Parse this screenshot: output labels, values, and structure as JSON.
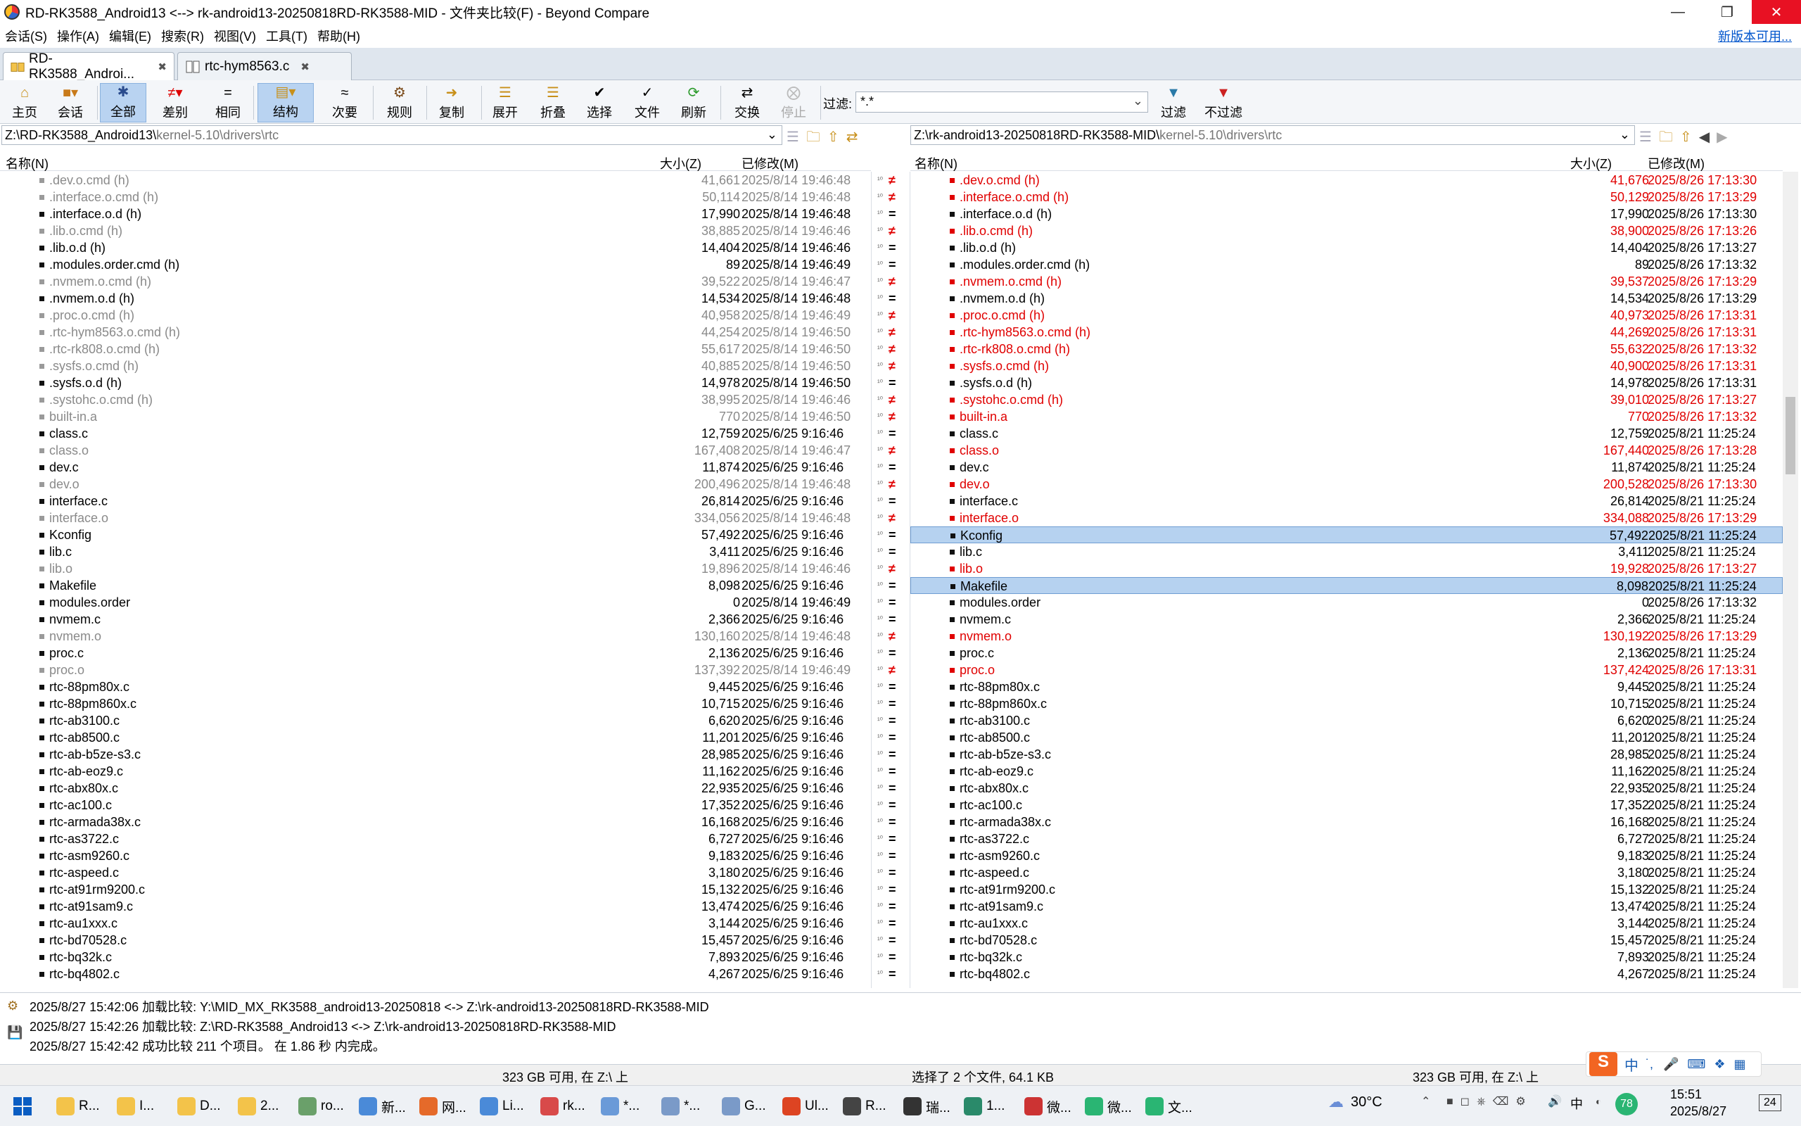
{
  "window": {
    "title": "RD-RK3588_Android13 <--> rk-android13-20250818RD-RK3588-MID - 文件夹比较(F) - Beyond Compare"
  },
  "menu": {
    "items": [
      "会话(S)",
      "操作(A)",
      "编辑(E)",
      "搜索(R)",
      "视图(V)",
      "工具(T)",
      "帮助(H)"
    ],
    "new_version": "新版本可用..."
  },
  "tabs": [
    {
      "label": "RD-RK3588_Androi..."
    },
    {
      "label": "rtc-hym8563.c"
    }
  ],
  "toolbar": {
    "buttons": [
      "主页",
      "会话",
      "全部",
      "差别",
      "相同",
      "结构",
      "次要",
      "规则",
      "复制",
      "展开",
      "折叠",
      "选择",
      "文件",
      "刷新",
      "交换",
      "停止"
    ],
    "filter_label": "过滤:",
    "filter_value": "*.*",
    "filter_btn": "过滤",
    "nofilter_btn": "不过滤"
  },
  "left": {
    "path_prefix": "Z:\\RD-RK3588_Android13\\",
    "path_suffix": "kernel-5.10\\drivers\\rtc",
    "col_name": "名称(N)",
    "col_size": "大小(Z)",
    "col_mod": "已修改(M)",
    "rows": [
      {
        "name": ".dev.o.cmd (h)",
        "size": "41,661",
        "date": "2025/8/14 19:46:48",
        "s": "gray"
      },
      {
        "name": ".interface.o.cmd (h)",
        "size": "50,114",
        "date": "2025/8/14 19:46:48",
        "s": "gray"
      },
      {
        "name": ".interface.o.d (h)",
        "size": "17,990",
        "date": "2025/8/14 19:46:48",
        "s": ""
      },
      {
        "name": ".lib.o.cmd (h)",
        "size": "38,885",
        "date": "2025/8/14 19:46:46",
        "s": "gray"
      },
      {
        "name": ".lib.o.d (h)",
        "size": "14,404",
        "date": "2025/8/14 19:46:46",
        "s": ""
      },
      {
        "name": ".modules.order.cmd (h)",
        "size": "89",
        "date": "2025/8/14 19:46:49",
        "s": ""
      },
      {
        "name": ".nvmem.o.cmd (h)",
        "size": "39,522",
        "date": "2025/8/14 19:46:47",
        "s": "gray"
      },
      {
        "name": ".nvmem.o.d (h)",
        "size": "14,534",
        "date": "2025/8/14 19:46:48",
        "s": ""
      },
      {
        "name": ".proc.o.cmd (h)",
        "size": "40,958",
        "date": "2025/8/14 19:46:49",
        "s": "gray"
      },
      {
        "name": ".rtc-hym8563.o.cmd (h)",
        "size": "44,254",
        "date": "2025/8/14 19:46:50",
        "s": "gray"
      },
      {
        "name": ".rtc-rk808.o.cmd (h)",
        "size": "55,617",
        "date": "2025/8/14 19:46:50",
        "s": "gray"
      },
      {
        "name": ".sysfs.o.cmd (h)",
        "size": "40,885",
        "date": "2025/8/14 19:46:50",
        "s": "gray"
      },
      {
        "name": ".sysfs.o.d (h)",
        "size": "14,978",
        "date": "2025/8/14 19:46:50",
        "s": ""
      },
      {
        "name": ".systohc.o.cmd (h)",
        "size": "38,995",
        "date": "2025/8/14 19:46:46",
        "s": "gray"
      },
      {
        "name": "built-in.a",
        "size": "770",
        "date": "2025/8/14 19:46:50",
        "s": "gray"
      },
      {
        "name": "class.c",
        "size": "12,759",
        "date": "2025/6/25 9:16:46",
        "s": ""
      },
      {
        "name": "class.o",
        "size": "167,408",
        "date": "2025/8/14 19:46:47",
        "s": "gray"
      },
      {
        "name": "dev.c",
        "size": "11,874",
        "date": "2025/6/25 9:16:46",
        "s": ""
      },
      {
        "name": "dev.o",
        "size": "200,496",
        "date": "2025/8/14 19:46:48",
        "s": "gray"
      },
      {
        "name": "interface.c",
        "size": "26,814",
        "date": "2025/6/25 9:16:46",
        "s": ""
      },
      {
        "name": "interface.o",
        "size": "334,056",
        "date": "2025/8/14 19:46:48",
        "s": "gray"
      },
      {
        "name": "Kconfig",
        "size": "57,492",
        "date": "2025/6/25 9:16:46",
        "s": ""
      },
      {
        "name": "lib.c",
        "size": "3,411",
        "date": "2025/6/25 9:16:46",
        "s": ""
      },
      {
        "name": "lib.o",
        "size": "19,896",
        "date": "2025/8/14 19:46:46",
        "s": "gray"
      },
      {
        "name": "Makefile",
        "size": "8,098",
        "date": "2025/6/25 9:16:46",
        "s": ""
      },
      {
        "name": "modules.order",
        "size": "0",
        "date": "2025/8/14 19:46:49",
        "s": ""
      },
      {
        "name": "nvmem.c",
        "size": "2,366",
        "date": "2025/6/25 9:16:46",
        "s": ""
      },
      {
        "name": "nvmem.o",
        "size": "130,160",
        "date": "2025/8/14 19:46:48",
        "s": "gray"
      },
      {
        "name": "proc.c",
        "size": "2,136",
        "date": "2025/6/25 9:16:46",
        "s": ""
      },
      {
        "name": "proc.o",
        "size": "137,392",
        "date": "2025/8/14 19:46:49",
        "s": "gray"
      },
      {
        "name": "rtc-88pm80x.c",
        "size": "9,445",
        "date": "2025/6/25 9:16:46",
        "s": ""
      },
      {
        "name": "rtc-88pm860x.c",
        "size": "10,715",
        "date": "2025/6/25 9:16:46",
        "s": ""
      },
      {
        "name": "rtc-ab3100.c",
        "size": "6,620",
        "date": "2025/6/25 9:16:46",
        "s": ""
      },
      {
        "name": "rtc-ab8500.c",
        "size": "11,201",
        "date": "2025/6/25 9:16:46",
        "s": ""
      },
      {
        "name": "rtc-ab-b5ze-s3.c",
        "size": "28,985",
        "date": "2025/6/25 9:16:46",
        "s": ""
      },
      {
        "name": "rtc-ab-eoz9.c",
        "size": "11,162",
        "date": "2025/6/25 9:16:46",
        "s": ""
      },
      {
        "name": "rtc-abx80x.c",
        "size": "22,935",
        "date": "2025/6/25 9:16:46",
        "s": ""
      },
      {
        "name": "rtc-ac100.c",
        "size": "17,352",
        "date": "2025/6/25 9:16:46",
        "s": ""
      },
      {
        "name": "rtc-armada38x.c",
        "size": "16,168",
        "date": "2025/6/25 9:16:46",
        "s": ""
      },
      {
        "name": "rtc-as3722.c",
        "size": "6,727",
        "date": "2025/6/25 9:16:46",
        "s": ""
      },
      {
        "name": "rtc-asm9260.c",
        "size": "9,183",
        "date": "2025/6/25 9:16:46",
        "s": ""
      },
      {
        "name": "rtc-aspeed.c",
        "size": "3,180",
        "date": "2025/6/25 9:16:46",
        "s": ""
      },
      {
        "name": "rtc-at91rm9200.c",
        "size": "15,132",
        "date": "2025/6/25 9:16:46",
        "s": ""
      },
      {
        "name": "rtc-at91sam9.c",
        "size": "13,474",
        "date": "2025/6/25 9:16:46",
        "s": ""
      },
      {
        "name": "rtc-au1xxx.c",
        "size": "3,144",
        "date": "2025/6/25 9:16:46",
        "s": ""
      },
      {
        "name": "rtc-bd70528.c",
        "size": "15,457",
        "date": "2025/6/25 9:16:46",
        "s": ""
      },
      {
        "name": "rtc-bq32k.c",
        "size": "7,893",
        "date": "2025/6/25 9:16:46",
        "s": ""
      },
      {
        "name": "rtc-bq4802.c",
        "size": "4,267",
        "date": "2025/6/25 9:16:46",
        "s": ""
      }
    ]
  },
  "right": {
    "path_prefix": "Z:\\rk-android13-20250818RD-RK3588-MID\\",
    "path_suffix": "kernel-5.10\\drivers\\rtc",
    "col_name": "名称(N)",
    "col_size": "大小(Z)",
    "col_mod": "已修改(M)",
    "rows": [
      {
        "name": ".dev.o.cmd (h)",
        "size": "41,676",
        "date": "2025/8/26 17:13:30",
        "s": "red"
      },
      {
        "name": ".interface.o.cmd (h)",
        "size": "50,129",
        "date": "2025/8/26 17:13:29",
        "s": "red"
      },
      {
        "name": ".interface.o.d (h)",
        "size": "17,990",
        "date": "2025/8/26 17:13:30",
        "s": ""
      },
      {
        "name": ".lib.o.cmd (h)",
        "size": "38,900",
        "date": "2025/8/26 17:13:26",
        "s": "red"
      },
      {
        "name": ".lib.o.d (h)",
        "size": "14,404",
        "date": "2025/8/26 17:13:27",
        "s": ""
      },
      {
        "name": ".modules.order.cmd (h)",
        "size": "89",
        "date": "2025/8/26 17:13:32",
        "s": ""
      },
      {
        "name": ".nvmem.o.cmd (h)",
        "size": "39,537",
        "date": "2025/8/26 17:13:29",
        "s": "red"
      },
      {
        "name": ".nvmem.o.d (h)",
        "size": "14,534",
        "date": "2025/8/26 17:13:29",
        "s": ""
      },
      {
        "name": ".proc.o.cmd (h)",
        "size": "40,973",
        "date": "2025/8/26 17:13:31",
        "s": "red"
      },
      {
        "name": ".rtc-hym8563.o.cmd (h)",
        "size": "44,269",
        "date": "2025/8/26 17:13:31",
        "s": "red"
      },
      {
        "name": ".rtc-rk808.o.cmd (h)",
        "size": "55,632",
        "date": "2025/8/26 17:13:32",
        "s": "red"
      },
      {
        "name": ".sysfs.o.cmd (h)",
        "size": "40,900",
        "date": "2025/8/26 17:13:31",
        "s": "red"
      },
      {
        "name": ".sysfs.o.d (h)",
        "size": "14,978",
        "date": "2025/8/26 17:13:31",
        "s": ""
      },
      {
        "name": ".systohc.o.cmd (h)",
        "size": "39,010",
        "date": "2025/8/26 17:13:27",
        "s": "red"
      },
      {
        "name": "built-in.a",
        "size": "770",
        "date": "2025/8/26 17:13:32",
        "s": "red"
      },
      {
        "name": "class.c",
        "size": "12,759",
        "date": "2025/8/21 11:25:24",
        "s": ""
      },
      {
        "name": "class.o",
        "size": "167,440",
        "date": "2025/8/26 17:13:28",
        "s": "red"
      },
      {
        "name": "dev.c",
        "size": "11,874",
        "date": "2025/8/21 11:25:24",
        "s": ""
      },
      {
        "name": "dev.o",
        "size": "200,528",
        "date": "2025/8/26 17:13:30",
        "s": "red"
      },
      {
        "name": "interface.c",
        "size": "26,814",
        "date": "2025/8/21 11:25:24",
        "s": ""
      },
      {
        "name": "interface.o",
        "size": "334,088",
        "date": "2025/8/26 17:13:29",
        "s": "red"
      },
      {
        "name": "Kconfig",
        "size": "57,492",
        "date": "2025/8/21 11:25:24",
        "s": "sel"
      },
      {
        "name": "lib.c",
        "size": "3,411",
        "date": "2025/8/21 11:25:24",
        "s": ""
      },
      {
        "name": "lib.o",
        "size": "19,928",
        "date": "2025/8/26 17:13:27",
        "s": "red"
      },
      {
        "name": "Makefile",
        "size": "8,098",
        "date": "2025/8/21 11:25:24",
        "s": "sel"
      },
      {
        "name": "modules.order",
        "size": "0",
        "date": "2025/8/26 17:13:32",
        "s": ""
      },
      {
        "name": "nvmem.c",
        "size": "2,366",
        "date": "2025/8/21 11:25:24",
        "s": ""
      },
      {
        "name": "nvmem.o",
        "size": "130,192",
        "date": "2025/8/26 17:13:29",
        "s": "red"
      },
      {
        "name": "proc.c",
        "size": "2,136",
        "date": "2025/8/21 11:25:24",
        "s": ""
      },
      {
        "name": "proc.o",
        "size": "137,424",
        "date": "2025/8/26 17:13:31",
        "s": "red"
      },
      {
        "name": "rtc-88pm80x.c",
        "size": "9,445",
        "date": "2025/8/21 11:25:24",
        "s": ""
      },
      {
        "name": "rtc-88pm860x.c",
        "size": "10,715",
        "date": "2025/8/21 11:25:24",
        "s": ""
      },
      {
        "name": "rtc-ab3100.c",
        "size": "6,620",
        "date": "2025/8/21 11:25:24",
        "s": ""
      },
      {
        "name": "rtc-ab8500.c",
        "size": "11,201",
        "date": "2025/8/21 11:25:24",
        "s": ""
      },
      {
        "name": "rtc-ab-b5ze-s3.c",
        "size": "28,985",
        "date": "2025/8/21 11:25:24",
        "s": ""
      },
      {
        "name": "rtc-ab-eoz9.c",
        "size": "11,162",
        "date": "2025/8/21 11:25:24",
        "s": ""
      },
      {
        "name": "rtc-abx80x.c",
        "size": "22,935",
        "date": "2025/8/21 11:25:24",
        "s": ""
      },
      {
        "name": "rtc-ac100.c",
        "size": "17,352",
        "date": "2025/8/21 11:25:24",
        "s": ""
      },
      {
        "name": "rtc-armada38x.c",
        "size": "16,168",
        "date": "2025/8/21 11:25:24",
        "s": ""
      },
      {
        "name": "rtc-as3722.c",
        "size": "6,727",
        "date": "2025/8/21 11:25:24",
        "s": ""
      },
      {
        "name": "rtc-asm9260.c",
        "size": "9,183",
        "date": "2025/8/21 11:25:24",
        "s": ""
      },
      {
        "name": "rtc-aspeed.c",
        "size": "3,180",
        "date": "2025/8/21 11:25:24",
        "s": ""
      },
      {
        "name": "rtc-at91rm9200.c",
        "size": "15,132",
        "date": "2025/8/21 11:25:24",
        "s": ""
      },
      {
        "name": "rtc-at91sam9.c",
        "size": "13,474",
        "date": "2025/8/21 11:25:24",
        "s": ""
      },
      {
        "name": "rtc-au1xxx.c",
        "size": "3,144",
        "date": "2025/8/21 11:25:24",
        "s": ""
      },
      {
        "name": "rtc-bd70528.c",
        "size": "15,457",
        "date": "2025/8/21 11:25:24",
        "s": ""
      },
      {
        "name": "rtc-bq32k.c",
        "size": "7,893",
        "date": "2025/8/21 11:25:24",
        "s": ""
      },
      {
        "name": "rtc-bq4802.c",
        "size": "4,267",
        "date": "2025/8/21 11:25:24",
        "s": ""
      }
    ]
  },
  "markers": [
    "ne",
    "ne",
    "eq",
    "ne",
    "eq",
    "eq",
    "ne",
    "eq",
    "ne",
    "ne",
    "ne",
    "ne",
    "eq",
    "ne",
    "ne",
    "eq",
    "ne",
    "eq",
    "ne",
    "eq",
    "ne",
    "eq",
    "eq",
    "ne",
    "eq",
    "eq",
    "eq",
    "ne",
    "eq",
    "ne",
    "eq",
    "eq",
    "eq",
    "eq",
    "eq",
    "eq",
    "eq",
    "eq",
    "eq",
    "eq",
    "eq",
    "eq",
    "eq",
    "eq",
    "eq",
    "eq",
    "eq",
    "eq"
  ],
  "log": [
    "2025/8/27 15:42:06  加载比较: Y:\\MID_MX_RK3588_android13-20250818 <-> Z:\\rk-android13-20250818RD-RK3588-MID",
    "2025/8/27 15:42:26  加载比较: Z:\\RD-RK3588_Android13 <-> Z:\\rk-android13-20250818RD-RK3588-MID",
    "2025/8/27 15:42:42  成功比较 211 个项目。 在 1.86 秒 内完成。"
  ],
  "status": {
    "left_free": "323 GB 可用, 在 Z:\\ 上",
    "selection": "选择了 2 个文件, 64.1 KB",
    "right_free": "323 GB 可用, 在 Z:\\ 上"
  },
  "taskbar": {
    "apps": [
      "R...",
      "I...",
      "D...",
      "2...",
      "ro...",
      "新...",
      "网...",
      "Li...",
      "rk...",
      "*...",
      "*...",
      "G...",
      "Ul...",
      "R...",
      "瑞...",
      "1...",
      "微...",
      "微...",
      "文..."
    ],
    "weather": "30°C",
    "ime": "中",
    "badge": "78",
    "time": "15:51",
    "date": "2025/8/27",
    "notif": "24"
  }
}
